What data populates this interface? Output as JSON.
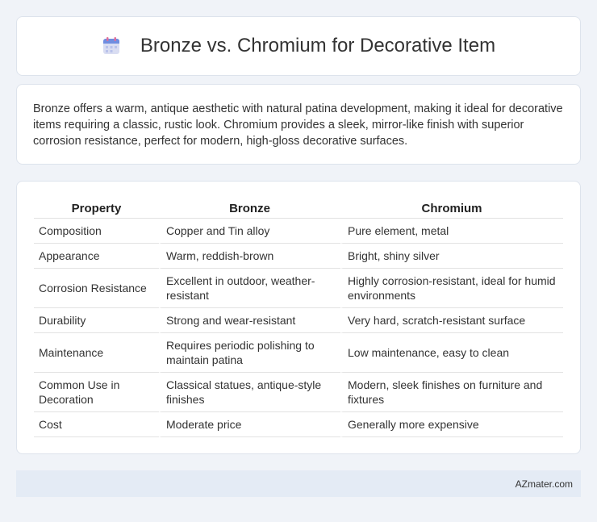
{
  "header": {
    "icon": "calendar-icon",
    "title": "Bronze vs. Chromium for Decorative Item"
  },
  "summary": {
    "text": "Bronze offers a warm, antique aesthetic with natural patina development, making it ideal for decorative items requiring a classic, rustic look. Chromium provides a sleek, mirror-like finish with superior corrosion resistance, perfect for modern, high-gloss decorative surfaces."
  },
  "table": {
    "headers": [
      "Property",
      "Bronze",
      "Chromium"
    ],
    "rows": [
      [
        "Composition",
        "Copper and Tin alloy",
        "Pure element, metal"
      ],
      [
        "Appearance",
        "Warm, reddish-brown",
        "Bright, shiny silver"
      ],
      [
        "Corrosion Resistance",
        "Excellent in outdoor, weather-resistant",
        "Highly corrosion-resistant, ideal for humid environments"
      ],
      [
        "Durability",
        "Strong and wear-resistant",
        "Very hard, scratch-resistant surface"
      ],
      [
        "Maintenance",
        "Requires periodic polishing to maintain patina",
        "Low maintenance, easy to clean"
      ],
      [
        "Common Use in Decoration",
        "Classical statues, antique-style finishes",
        "Modern, sleek finishes on furniture and fixtures"
      ],
      [
        "Cost",
        "Moderate price",
        "Generally more expensive"
      ]
    ]
  },
  "footer": {
    "site": "AZmater.com"
  }
}
